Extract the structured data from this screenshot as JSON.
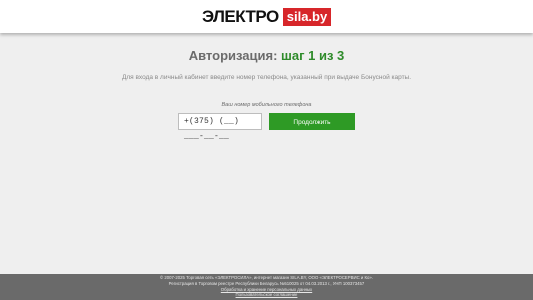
{
  "header": {
    "logo_main": "ЭЛЕКТРО",
    "logo_site": "sila.by"
  },
  "auth": {
    "title": "Авторизация:",
    "step": "шаг 1 из 3",
    "subtitle": "Для входа в личный кабинет введите номер телефона, указанный при выдаче Бонусной карты.",
    "phone_label": "Ваш номер мобильного телефона",
    "phone_value": "+(375) (__) ___-__-__",
    "continue_label": "Продолжить"
  },
  "footer": {
    "line1": "© 2007-2025 Торговая сеть «ЭЛЕКТРОСИЛА», интернет магазин SILA.BY, ООО «ЭЛЕКТРОСЕРВИС и Ко».",
    "line2": "Регистрация в Торговом реестре Республики Беларусь №510025 от 04.03.2013 г., УНП 100373457",
    "line3": "Обработка и хранение персональных данных",
    "line4": "Пользовательское соглашение"
  }
}
